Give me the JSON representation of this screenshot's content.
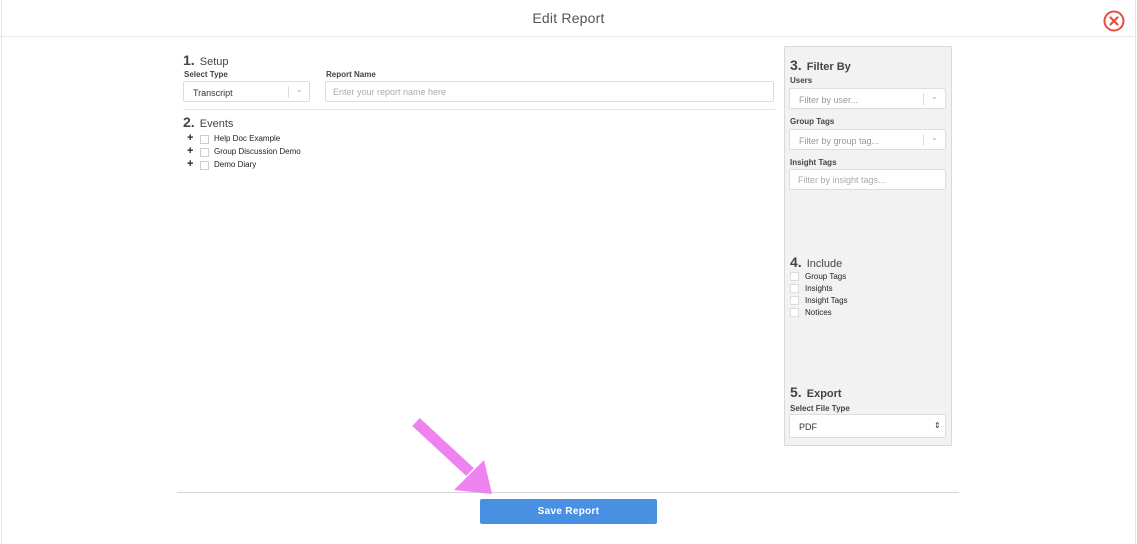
{
  "header": {
    "title": "Edit Report"
  },
  "setup": {
    "number": "1.",
    "title": "Setup",
    "select_type_label": "Select Type",
    "select_type_value": "Transcript",
    "report_name_label": "Report Name",
    "report_name_placeholder": "Enter your report name here"
  },
  "events": {
    "number": "2.",
    "title": "Events",
    "items": [
      {
        "label": "Help Doc Example"
      },
      {
        "label": "Group Discussion Demo"
      },
      {
        "label": "Demo Diary"
      }
    ]
  },
  "filter": {
    "number": "3.",
    "title": "Filter By",
    "users_label": "Users",
    "users_placeholder": "Filter by user...",
    "group_tags_label": "Group Tags",
    "group_tags_placeholder": "Filter by group tag...",
    "insight_tags_label": "Insight Tags",
    "insight_tags_placeholder": "Filter by insight tags..."
  },
  "include": {
    "number": "4.",
    "title": "Include",
    "items": [
      {
        "label": "Group Tags"
      },
      {
        "label": "Insights"
      },
      {
        "label": "Insight Tags"
      },
      {
        "label": "Notices"
      }
    ]
  },
  "export": {
    "number": "5.",
    "title": "Export",
    "file_type_label": "Select File Type",
    "file_type_value": "PDF"
  },
  "footer": {
    "save_label": "Save Report"
  },
  "colors": {
    "accent": "#4a90e2",
    "close": "#e74c3c",
    "annotation_arrow": "#ee82ee"
  }
}
